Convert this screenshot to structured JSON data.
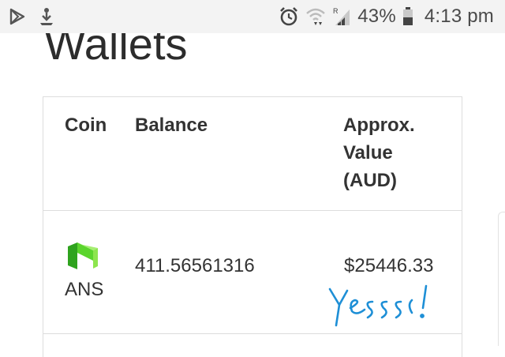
{
  "status_bar": {
    "icons_left": [
      "play-store-icon",
      "download-icon"
    ],
    "icons_right": [
      "alarm-icon",
      "wifi-icon",
      "signal-icon",
      "battery-icon"
    ],
    "roaming_indicator": "R",
    "battery": "43%",
    "time": "4:13 pm"
  },
  "page": {
    "title": "Wallets"
  },
  "table": {
    "headers": {
      "coin": "Coin",
      "balance": "Balance",
      "value_line1": "Approx.",
      "value_line2": "Value",
      "value_line3": "(AUD)"
    },
    "rows": [
      {
        "coin": "ANS",
        "logo": "neo-logo",
        "balance": "411.56561316",
        "value": "$25446.33"
      }
    ]
  },
  "annotation": {
    "text": "Yesss!",
    "color": "#1e8fd6"
  },
  "colors": {
    "status_bar_bg": "#f3f3f3",
    "border": "#dddddd",
    "logo_green": "#5bd52d",
    "handwriting_blue": "#1e8fd6"
  }
}
